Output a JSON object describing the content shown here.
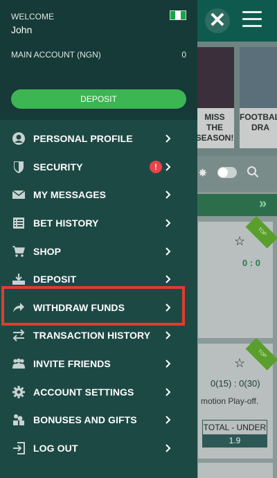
{
  "header": {
    "welcome_label": "WELCOME",
    "username": "John",
    "account_label": "MAIN ACCOUNT (NGN)",
    "account_balance": "0",
    "deposit_button": "DEPOSIT",
    "flag_colors": [
      "#1aa34a",
      "#ffffff",
      "#1aa34a"
    ]
  },
  "menu": {
    "items": [
      {
        "label": "PERSONAL PROFILE",
        "icon": "person-icon"
      },
      {
        "label": "SECURITY",
        "icon": "shield-icon",
        "badge": "!"
      },
      {
        "label": "MY MESSAGES",
        "icon": "envelope-icon"
      },
      {
        "label": "BET HISTORY",
        "icon": "list-icon"
      },
      {
        "label": "SHOP",
        "icon": "cart-icon"
      },
      {
        "label": "DEPOSIT",
        "icon": "download-icon"
      },
      {
        "label": "WITHDRAW FUNDS",
        "icon": "share-arrow-icon",
        "highlighted": true
      },
      {
        "label": "TRANSACTION HISTORY",
        "icon": "swap-arrows-icon"
      },
      {
        "label": "INVITE FRIENDS",
        "icon": "people-icon"
      },
      {
        "label": "ACCOUNT SETTINGS",
        "icon": "gear-icon"
      },
      {
        "label": "BONUSES AND GIFTS",
        "icon": "gift-icon"
      },
      {
        "label": "LOG OUT",
        "icon": "logout-icon"
      }
    ]
  },
  "background": {
    "promos": [
      {
        "caption": "MISS THE SEASON!"
      },
      {
        "caption": "FOOTBALL DRA"
      }
    ],
    "cards": [
      {
        "score": "0 : 0",
        "ribbon": "TOP"
      },
      {
        "score": "0(15) : 0(30)",
        "text": "motion Play-off.",
        "total_label": "TOTAL - UNDER",
        "total_value": "1.9",
        "ribbon": "TOP"
      }
    ]
  },
  "colors": {
    "accent_green": "#3cb552",
    "drawer_bg": "#1d4945",
    "drawer_head_bg": "#153a37",
    "highlight_red": "#e23b30",
    "badge_red": "#e8444a"
  }
}
